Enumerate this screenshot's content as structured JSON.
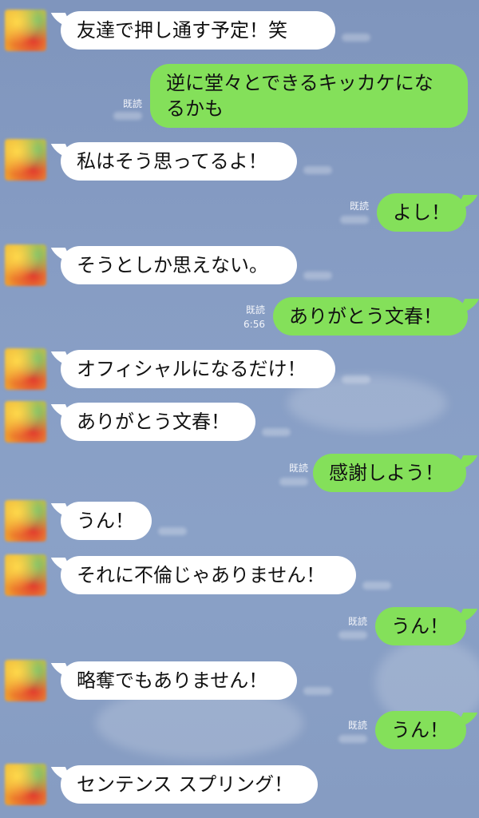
{
  "messages": [
    {
      "side": "left",
      "text": "友達で押し通す予定！笑"
    },
    {
      "side": "right",
      "text": "逆に堂々とできるキッカケになるかも",
      "read_label": "既読"
    },
    {
      "side": "left",
      "text": "私はそう思ってるよ！"
    },
    {
      "side": "right",
      "text": "よし！",
      "read_label": "既読"
    },
    {
      "side": "left",
      "text": "そうとしか思えない。"
    },
    {
      "side": "right",
      "text": "ありがとう文春！",
      "read_label": "既読",
      "time": "6:56"
    },
    {
      "side": "left",
      "text": "オフィシャルになるだけ！"
    },
    {
      "side": "left",
      "text": "ありがとう文春！"
    },
    {
      "side": "right",
      "text": "感謝しよう！",
      "read_label": "既読"
    },
    {
      "side": "left",
      "text": "うん！"
    },
    {
      "side": "left",
      "text": "それに不倫じゃありません！"
    },
    {
      "side": "right",
      "text": "うん！",
      "read_label": "既読"
    },
    {
      "side": "left",
      "text": "略奪でもありません！"
    },
    {
      "side": "right",
      "text": "うん！",
      "read_label": "既読"
    },
    {
      "side": "left",
      "text": "センテンス スプリング！"
    }
  ],
  "colors": {
    "background": "#879dc4",
    "incoming_bubble": "#ffffff",
    "outgoing_bubble": "#84e05a"
  }
}
